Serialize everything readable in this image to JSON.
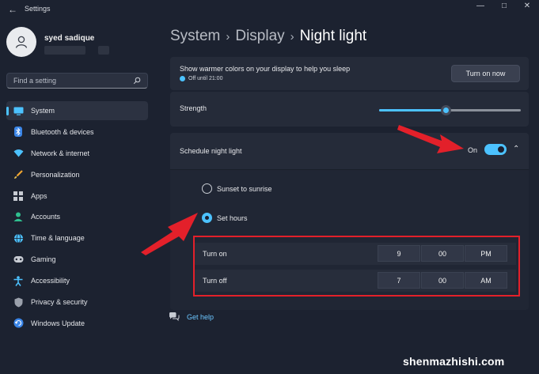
{
  "window": {
    "title": "Settings"
  },
  "account": {
    "name": "syed sadique"
  },
  "search": {
    "placeholder": "Find a setting"
  },
  "nav": [
    {
      "label": "System",
      "icon": "monitor-icon",
      "active": true
    },
    {
      "label": "Bluetooth & devices",
      "icon": "bluetooth-icon"
    },
    {
      "label": "Network & internet",
      "icon": "wifi-icon"
    },
    {
      "label": "Personalization",
      "icon": "brush-icon"
    },
    {
      "label": "Apps",
      "icon": "apps-icon"
    },
    {
      "label": "Accounts",
      "icon": "person-icon"
    },
    {
      "label": "Time & language",
      "icon": "globe-icon"
    },
    {
      "label": "Gaming",
      "icon": "gamepad-icon"
    },
    {
      "label": "Accessibility",
      "icon": "accessibility-icon"
    },
    {
      "label": "Privacy & security",
      "icon": "shield-icon"
    },
    {
      "label": "Windows Update",
      "icon": "update-icon"
    }
  ],
  "breadcrumb": {
    "level1": "System",
    "level2": "Display",
    "current": "Night light"
  },
  "warm": {
    "description": "Show warmer colors on your display to help you sleep",
    "status": "Off until 21:00",
    "button": "Turn on now"
  },
  "strength": {
    "label": "Strength",
    "value_percent": 47
  },
  "schedule": {
    "label": "Schedule night light",
    "state": "On",
    "options": [
      "Sunset to sunrise",
      "Set hours"
    ],
    "selected": "Set hours",
    "turn_on": {
      "label": "Turn on",
      "hour": "9",
      "minute": "00",
      "period": "PM"
    },
    "turn_off": {
      "label": "Turn off",
      "hour": "7",
      "minute": "00",
      "period": "AM"
    }
  },
  "help": {
    "label": "Get help"
  },
  "watermark": "shenmazhishi.com",
  "colors": {
    "accent": "#4cc2ff",
    "highlight": "#e3202a",
    "background": "#1c2230",
    "card": "#252b39"
  }
}
